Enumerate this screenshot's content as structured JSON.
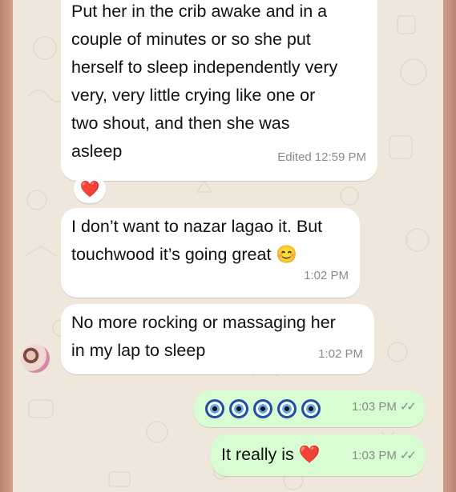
{
  "colors": {
    "chat_background": "#efe7dc",
    "incoming_bubble": "#ffffff",
    "outgoing_bubble": "#d9fdd3",
    "meta_text": "#8a8a8a"
  },
  "messages": [
    {
      "direction": "incoming",
      "lines": [
        "Put her in the crib awake and in a",
        "couple of minutes or so she put",
        "herself to sleep independently very",
        "very, very little crying like one or",
        "two shout, and then she was",
        "asleep"
      ],
      "edited_label": "Edited",
      "time": "12:59 PM",
      "reaction": "❤️"
    },
    {
      "direction": "incoming",
      "lines": [
        "I don’t want to nazar lagao it. But",
        "touchwood it’s going great 😊"
      ],
      "time": "1:02 PM"
    },
    {
      "direction": "incoming",
      "lines": [
        "No more rocking or massaging her",
        "in my lap to sleep"
      ],
      "time": "1:02 PM",
      "has_avatar": true
    },
    {
      "direction": "outgoing",
      "emoji_count": 5,
      "emoji_icon": "nazar-amulet-icon",
      "time": "1:03 PM",
      "status_icon": "double-check-icon"
    },
    {
      "direction": "outgoing",
      "text": "It really is ❤️",
      "time": "1:03 PM",
      "status_icon": "double-check-icon"
    }
  ],
  "ticks_glyph": "✓✓"
}
